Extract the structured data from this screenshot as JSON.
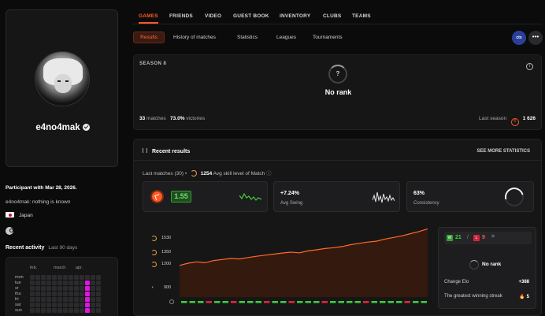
{
  "profile": {
    "username": "e4no4mak",
    "participant_since": "Participant with Mar 28, 2026.",
    "bio": "e4no4mak: nothing is known",
    "country": "Japan"
  },
  "activity": {
    "title": "Recent activity",
    "period": "Last 90 days",
    "months": [
      "feb.",
      "march",
      "apr."
    ],
    "days": [
      "mon",
      "tue",
      "sr",
      "thu",
      "fri",
      "sat",
      "sun"
    ]
  },
  "nav": {
    "main_tabs": [
      "GAMES",
      "FRIENDS",
      "VIDEO",
      "GUEST BOOK",
      "INVENTORY",
      "CLUBS",
      "TEAMS"
    ],
    "sub_tabs": [
      "Results",
      "History of matches",
      "Statistics",
      "Leagues",
      "Tournaments"
    ],
    "team_tag": "ctx",
    "more": "•••"
  },
  "season": {
    "title": "SEASON 8",
    "rank_symbol": "?",
    "rank": "No rank",
    "matches_count": "33",
    "matches_label": "matches",
    "victories_pct": "73.0%",
    "victories_label": "victories",
    "last_season_label": "Last season",
    "last_season_badge": "6",
    "last_season_value": "1 626"
  },
  "results": {
    "title": "Recent results",
    "see_more": "SEE MORE STATISTICS",
    "last_matches": "Last matches (30) •",
    "avg_skill_value": "1254",
    "avg_skill_label": "Avg skill level of Match",
    "elo_value": "1.55",
    "swing_value": "+7.24%",
    "swing_label": "Avg Swing",
    "consistency_value": "63%",
    "consistency_label": "Consistency"
  },
  "chart_data": {
    "type": "area",
    "yticks": [
      "1530",
      "1350",
      "1200",
      "900"
    ],
    "ylim": [
      900,
      1560
    ],
    "values": [
      1195,
      1215,
      1228,
      1220,
      1240,
      1250,
      1260,
      1255,
      1268,
      1280,
      1290,
      1300,
      1310,
      1318,
      1312,
      1330,
      1340,
      1352,
      1360,
      1370,
      1388,
      1400,
      1412,
      1420,
      1440,
      1455,
      1470,
      1490,
      1510,
      1535
    ],
    "results": [
      "W",
      "W",
      "W",
      "L",
      "W",
      "W",
      "L",
      "W",
      "W",
      "W",
      "L",
      "W",
      "W",
      "L",
      "W",
      "W",
      "W",
      "L",
      "W",
      "W",
      "W",
      "W",
      "L",
      "W",
      "W",
      "W",
      "W",
      "L",
      "W",
      "W"
    ],
    "colors": {
      "line": "#ff6a2a",
      "win": "#3dd03d",
      "loss": "#e8233a"
    }
  },
  "streak": {
    "w_label": "W",
    "wins": "21",
    "slash": "/",
    "l_label": "L",
    "losses": "9",
    "chevron": ">",
    "rank": "No rank",
    "change_elo_label": "Change Elo",
    "change_elo_value": "+388",
    "win_streak_label": "The greatest winning streak",
    "win_streak_value": "5"
  },
  "colors": {
    "accent": "#ff5a24",
    "bg": "#0b0b0c",
    "panel": "#161617"
  }
}
